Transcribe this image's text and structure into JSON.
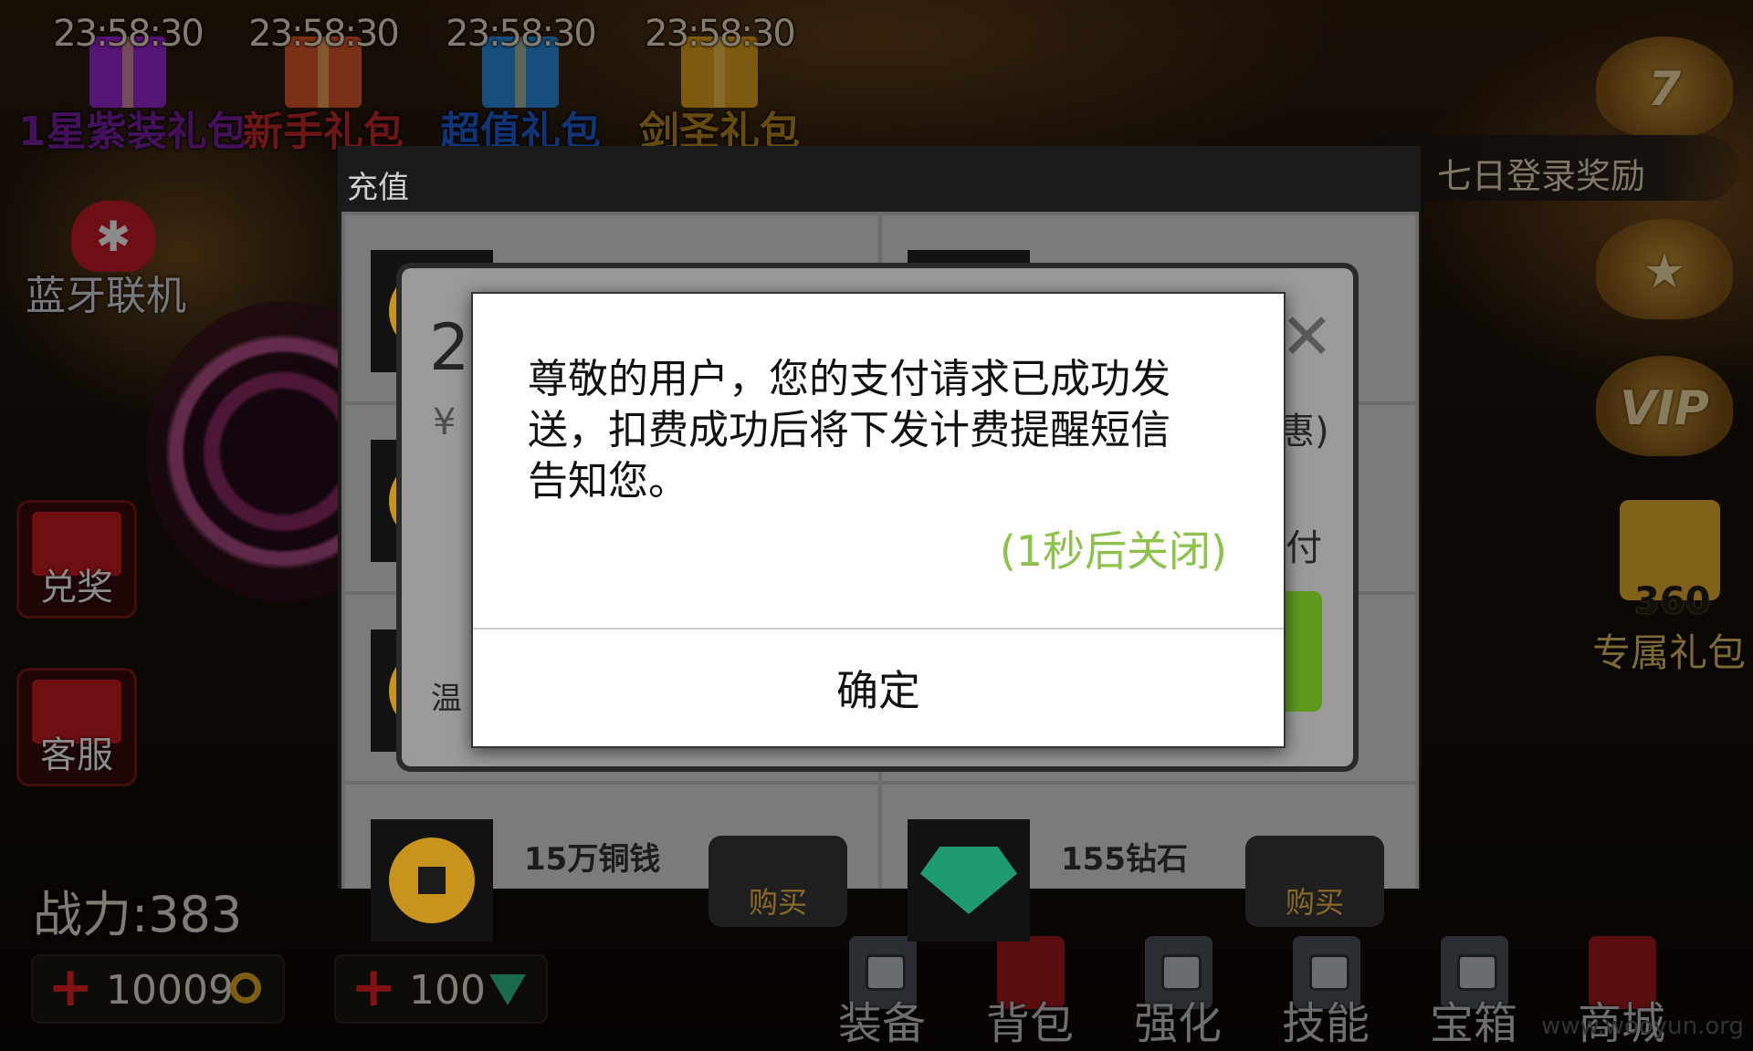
{
  "gifts": [
    {
      "timer": "23:58:30",
      "name": "1星紫装礼包",
      "name_color": "#7b1fa2",
      "box_color": "#9c27d6"
    },
    {
      "timer": "23:58:30",
      "name": "新手礼包",
      "name_color": "#c62828",
      "box_color": "#e0592a"
    },
    {
      "timer": "23:58:30",
      "name": "超值礼包",
      "name_color": "#1e5fd6",
      "box_color": "#2a8ee0"
    },
    {
      "timer": "23:58:30",
      "name": "剑圣礼包",
      "name_color": "#b98a1a",
      "box_color": "#e6a21e"
    }
  ],
  "left_menu": {
    "bluetooth_label": "蓝牙联机",
    "redeem_label": "兑奖",
    "service_label": "客服"
  },
  "power": {
    "text": "战力:383"
  },
  "currency": {
    "coins": "10009",
    "gems": "100"
  },
  "right_menu": {
    "seven_day": "七日登录奖励",
    "vip": "VIP",
    "gift360_num": "360",
    "gift360_label": "专属礼包"
  },
  "bottom_nav": [
    {
      "label": "装备",
      "locked": true
    },
    {
      "label": "背包",
      "locked": false
    },
    {
      "label": "强化",
      "locked": true
    },
    {
      "label": "技能",
      "locked": true
    },
    {
      "label": "宝箱",
      "locked": true
    },
    {
      "label": "商城",
      "locked": false
    }
  ],
  "recharge": {
    "title": "充值",
    "items": [
      {
        "name": "15万铜钱",
        "type": "coin",
        "buy": "购买"
      },
      {
        "name": "155钻石",
        "type": "gem",
        "buy": "购买"
      }
    ]
  },
  "payment_dialog": {
    "amount_prefix": "2",
    "currency_symbol": "¥",
    "close_glyph": "✕",
    "hint_fragment": "惠)",
    "pay_fragment": "付",
    "notice_fragment": "温"
  },
  "alert": {
    "message": "尊敬的用户，您的支付请求已成功发送，扣费成功后将下发计费提醒短信告知您。",
    "countdown": "(1秒后关闭)",
    "confirm": "确定"
  },
  "watermark": "www.wooyun.org"
}
